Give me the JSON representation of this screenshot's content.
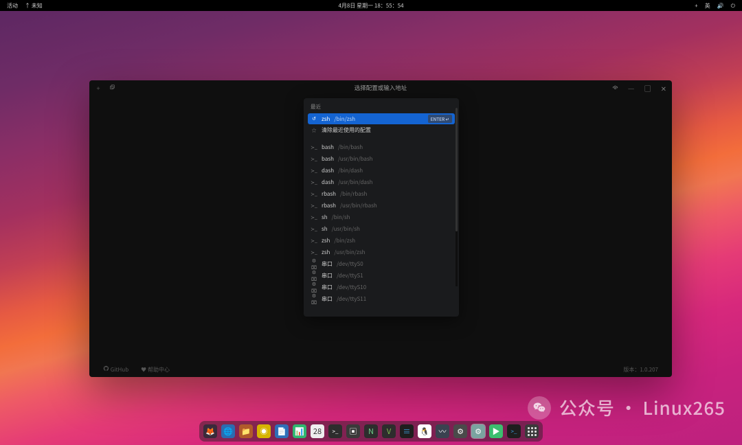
{
  "topbar": {
    "activities": "活动",
    "app": "未知",
    "datetime": "4月8日 星期一 18：55：54",
    "input_indicator": "英"
  },
  "window": {
    "title": "选择配置或输入地址",
    "footer_github": "GitHub",
    "footer_help": "帮助中心",
    "footer_version_label": "版本：",
    "footer_version": "1.0.207"
  },
  "dropdown": {
    "recent_label": "最近",
    "enter_badge": "ENTER",
    "items_recent": [
      {
        "icon": "history",
        "name": "zsh",
        "path": "/bin/zsh",
        "selected": true
      },
      {
        "icon": "star",
        "name": "清除最近使用的配置",
        "path": "",
        "selected": false
      }
    ],
    "items": [
      {
        "icon": "prompt",
        "name": "bash",
        "path": "/bin/bash"
      },
      {
        "icon": "prompt",
        "name": "bash",
        "path": "/usr/bin/bash"
      },
      {
        "icon": "prompt",
        "name": "dash",
        "path": "/bin/dash"
      },
      {
        "icon": "prompt",
        "name": "dash",
        "path": "/usr/bin/dash"
      },
      {
        "icon": "prompt",
        "name": "rbash",
        "path": "/bin/rbash"
      },
      {
        "icon": "prompt",
        "name": "rbash",
        "path": "/usr/bin/rbash"
      },
      {
        "icon": "prompt",
        "name": "sh",
        "path": "/bin/sh"
      },
      {
        "icon": "prompt",
        "name": "sh",
        "path": "/usr/bin/sh"
      },
      {
        "icon": "prompt",
        "name": "zsh",
        "path": "/bin/zsh"
      },
      {
        "icon": "prompt",
        "name": "zsh",
        "path": "/usr/bin/zsh"
      },
      {
        "icon": "serial",
        "name": "串口",
        "path": "/dev/ttyS0"
      },
      {
        "icon": "serial",
        "name": "串口",
        "path": "/dev/ttyS1"
      },
      {
        "icon": "serial",
        "name": "串口",
        "path": "/dev/ttyS10"
      },
      {
        "icon": "serial",
        "name": "串口",
        "path": "/dev/ttyS11"
      }
    ]
  },
  "dock": {
    "apps": [
      {
        "name": "firefox",
        "bg": "#3a2a3a",
        "glyph": "🦊"
      },
      {
        "name": "chromium",
        "bg": "#2b6cb0",
        "glyph": "🌐"
      },
      {
        "name": "files",
        "bg": "#b15a2b",
        "glyph": "📁"
      },
      {
        "name": "music",
        "bg": "#d7b500",
        "glyph": "◉"
      },
      {
        "name": "writer",
        "bg": "#2f6fb7",
        "glyph": "📄"
      },
      {
        "name": "calc",
        "bg": "#2fb770",
        "glyph": "📊"
      },
      {
        "name": "calendar",
        "bg": "#eeeeee",
        "glyph": "28",
        "fg": "#333"
      },
      {
        "name": "terminal",
        "bg": "#2d2d2d",
        "glyph": ">_"
      },
      {
        "name": "konsole",
        "bg": "#3a3a3a",
        "glyph": "▣"
      },
      {
        "name": "neovim",
        "bg": "#2d2d2d",
        "glyph": "N",
        "fg": "#6fd18a"
      },
      {
        "name": "gvim",
        "bg": "#2d2d2d",
        "glyph": "V",
        "fg": "#7fbf4f"
      },
      {
        "name": "vscode",
        "bg": "#1e1e1e",
        "glyph": "≡",
        "fg": "#3b9cdc"
      },
      {
        "name": "qq",
        "bg": "#ffffff",
        "glyph": "🐧"
      },
      {
        "name": "monitor",
        "bg": "#3a4250",
        "glyph": "〰"
      },
      {
        "name": "settings",
        "bg": "#4a4a4a",
        "glyph": "⚙"
      },
      {
        "name": "settings2",
        "bg": "#7aa4a0",
        "glyph": "⚙",
        "selected": true
      },
      {
        "name": "run",
        "bg": "#3cbf6f",
        "glyph": "▶"
      },
      {
        "name": "terminal2",
        "bg": "#1e1e1e",
        "glyph": ">_",
        "fg": "#3b9cdc"
      }
    ]
  },
  "watermark": {
    "text": "公众号 · Linux265"
  }
}
